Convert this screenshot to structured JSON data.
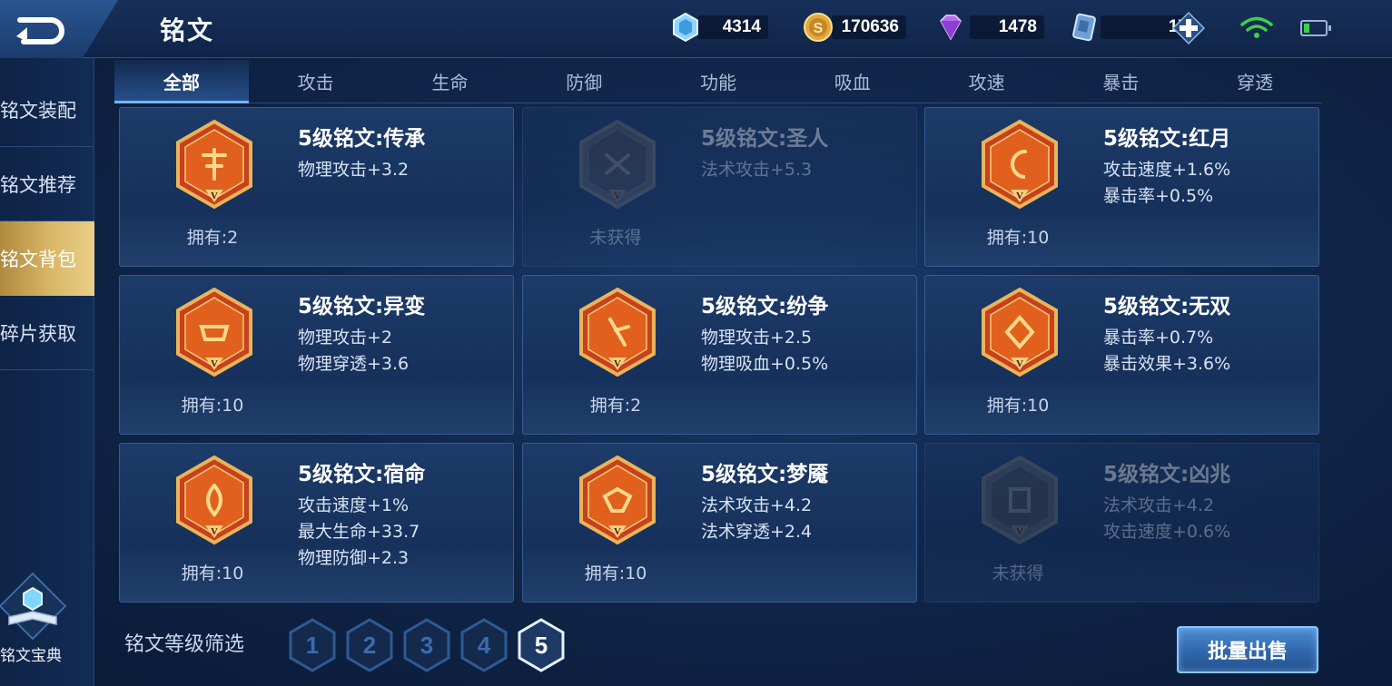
{
  "header": {
    "title": "铭文"
  },
  "currencies": [
    {
      "icon": "blue-crystal-icon",
      "value": "4314"
    },
    {
      "icon": "gold-coin-icon",
      "value": "170636"
    },
    {
      "icon": "purple-diamond-icon",
      "value": "1478"
    },
    {
      "icon": "ticket-icon",
      "value": "17"
    }
  ],
  "sidebar": {
    "items": [
      {
        "label": "铭文装配",
        "active": false
      },
      {
        "label": "铭文推荐",
        "active": false
      },
      {
        "label": "铭文背包",
        "active": true
      },
      {
        "label": "碎片获取",
        "active": false
      }
    ],
    "codex_label": "铭文宝典"
  },
  "tabs": [
    "全部",
    "攻击",
    "生命",
    "防御",
    "功能",
    "吸血",
    "攻速",
    "暴击",
    "穿透"
  ],
  "active_tab": "全部",
  "runes": [
    {
      "name": "5级铭文:传承",
      "stats": [
        "物理攻击+3.2"
      ],
      "owned": "拥有:2",
      "locked": false,
      "icon": "rune-chuancheng-icon"
    },
    {
      "name": "5级铭文:圣人",
      "stats": [
        "法术攻击+5.3"
      ],
      "owned": "未获得",
      "locked": true,
      "icon": "rune-shengren-icon"
    },
    {
      "name": "5级铭文:红月",
      "stats": [
        "攻击速度+1.6%",
        "暴击率+0.5%"
      ],
      "owned": "拥有:10",
      "locked": false,
      "icon": "rune-hongyue-icon"
    },
    {
      "name": "5级铭文:异变",
      "stats": [
        "物理攻击+2",
        "物理穿透+3.6"
      ],
      "owned": "拥有:10",
      "locked": false,
      "icon": "rune-yibian-icon"
    },
    {
      "name": "5级铭文:纷争",
      "stats": [
        "物理攻击+2.5",
        "物理吸血+0.5%"
      ],
      "owned": "拥有:2",
      "locked": false,
      "icon": "rune-fenzheng-icon"
    },
    {
      "name": "5级铭文:无双",
      "stats": [
        "暴击率+0.7%",
        "暴击效果+3.6%"
      ],
      "owned": "拥有:10",
      "locked": false,
      "icon": "rune-wushuang-icon"
    },
    {
      "name": "5级铭文:宿命",
      "stats": [
        "攻击速度+1%",
        "最大生命+33.7",
        "物理防御+2.3"
      ],
      "owned": "拥有:10",
      "locked": false,
      "icon": "rune-suming-icon"
    },
    {
      "name": "5级铭文:梦魇",
      "stats": [
        "法术攻击+4.2",
        "法术穿透+2.4"
      ],
      "owned": "拥有:10",
      "locked": false,
      "icon": "rune-mengyan-icon"
    },
    {
      "name": "5级铭文:凶兆",
      "stats": [
        "法术攻击+4.2",
        "攻击速度+0.6%"
      ],
      "owned": "未获得",
      "locked": true,
      "icon": "rune-xiongzhao-icon"
    }
  ],
  "filter": {
    "label": "铭文等级筛选",
    "levels": [
      "1",
      "2",
      "3",
      "4",
      "5"
    ],
    "selected": "5"
  },
  "sell_button": "批量出售",
  "colors": {
    "accent": "#6fb6ff",
    "gold": "#d9b867",
    "rune_red": "#c8401c"
  }
}
